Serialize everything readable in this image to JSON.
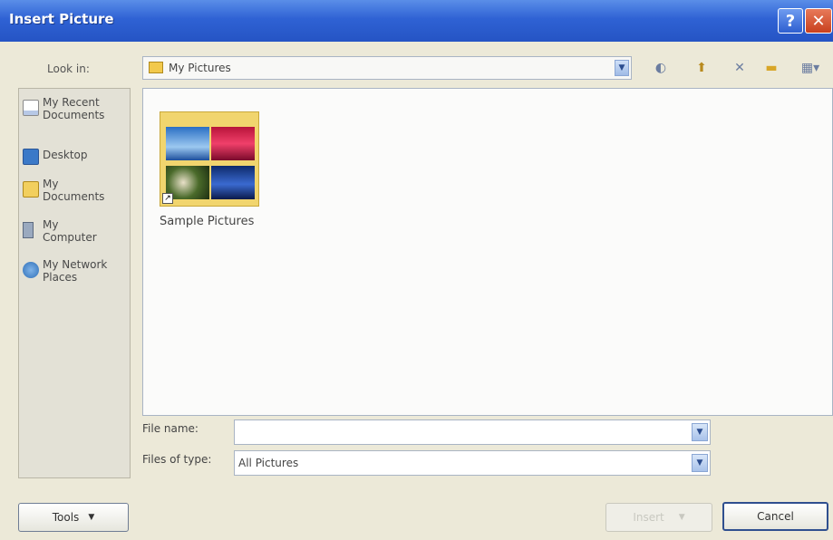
{
  "window": {
    "title": "Insert Picture",
    "help_glyph": "?",
    "close_glyph": "✕"
  },
  "lookin": {
    "label": "Look in:",
    "value": "My Pictures",
    "icon": "folder-icon"
  },
  "toolbar": {
    "items": [
      "back-icon",
      "up-folder-icon",
      "delete-icon",
      "new-folder-icon",
      "views-icon"
    ],
    "glyphs": {
      "back": "◐",
      "up": "⬆",
      "delete": "✕",
      "newfolder": "▬",
      "views": "▦▾"
    }
  },
  "places": [
    {
      "label": "My Recent Documents",
      "icon": "recent-documents-icon"
    },
    {
      "label": "Desktop",
      "icon": "desktop-icon"
    },
    {
      "label": "My Documents",
      "icon": "my-documents-icon"
    },
    {
      "label": "My Computer",
      "icon": "my-computer-icon"
    },
    {
      "label": "My Network Places",
      "icon": "network-places-icon"
    }
  ],
  "files": [
    {
      "name": "Sample Pictures",
      "type": "folder-shortcut"
    }
  ],
  "filename": {
    "label": "File name:",
    "value": ""
  },
  "filetype": {
    "label": "Files of type:",
    "value": "All Pictures"
  },
  "buttons": {
    "tools": "Tools",
    "insert": "Insert",
    "cancel": "Cancel"
  },
  "colors": {
    "titlebar": "#2554c4",
    "dialog_bg": "#ece9d8",
    "close": "#c8401e"
  }
}
